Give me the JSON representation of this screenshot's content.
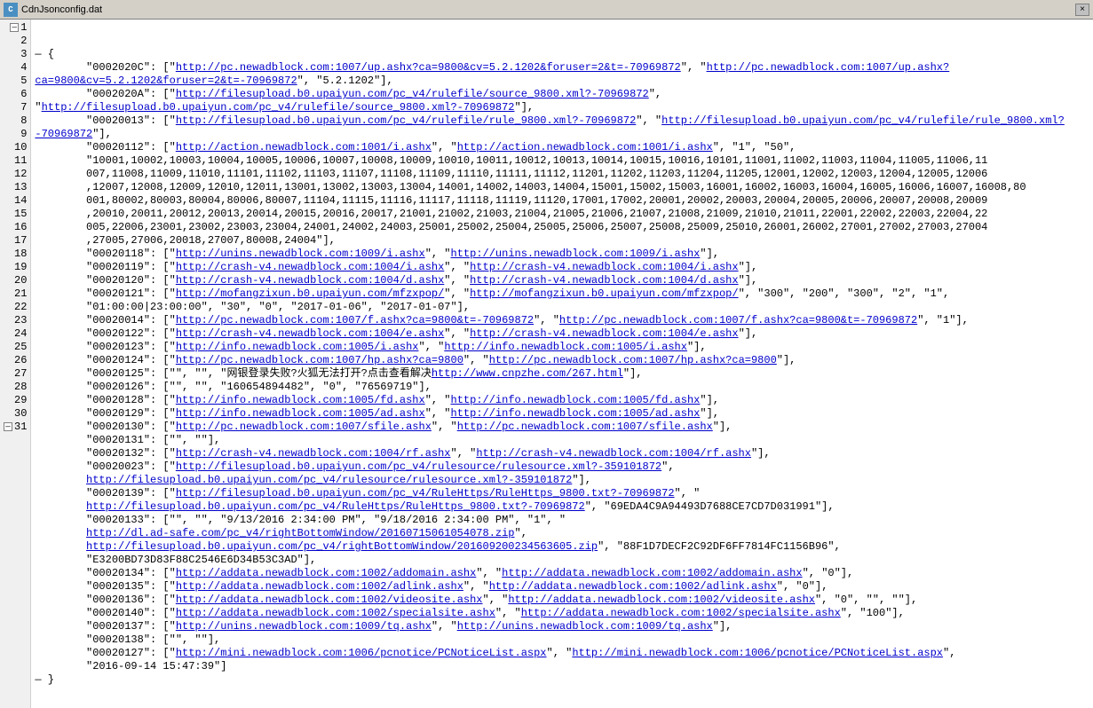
{
  "titleBar": {
    "title": "CdnJsonconfig.dat",
    "closeLabel": "×"
  },
  "lines": [
    {
      "num": 1,
      "hasCollapse": true,
      "text": "— {"
    },
    {
      "num": 2,
      "hasCollapse": false,
      "text": "        \"0002020C\": [\"<a>http://pc.newadblock.com:1007/up.ashx?ca=9800&cv=5.2.1202&foruser=2&t=-70969872</a>\", \"<a>http://pc.newadblock.com:1007/up.ashx?ca=9800&cv=5.2.1202&foruser=2&t=-70969872</a>\", \"5.2.1202\"],"
    },
    {
      "num": 3,
      "hasCollapse": false,
      "text": "        \"0002020A\": [\"<a>http://filesupload.b0.upaiyun.com/pc_v4/rulefile/source_9800.xml?-70969872</a>\", \"<a>http://filesupload.b0.upaiyun.com/pc_v4/rulefile/source_9800.xml?-70969872</a>\"],"
    },
    {
      "num": 4,
      "hasCollapse": false,
      "text": "        \"00020013\": [\"<a>http://filesupload.b0.upaiyun.com/pc_v4/rulefile/rule_9800.xml?-70969872</a>\", \"<a>http://filesupload.b0.upaiyun.com/pc_v4/rulefile/rule_9800.xml?-70969872</a>\"],"
    },
    {
      "num": 5,
      "hasCollapse": false,
      "text": "        \"00020112\": [\"<a>http://action.newadblock.com:1001/i.ashx</a>\", \"<a>http://action.newadblock.com:1001/i.ashx</a>\", \"1\", \"50\",\n        \"10001,10002,10003,10004,10005,10006,10007,10008,10009,10010,10011,10012,10013,10014,10015,10016,10101,11001,11002,11003,11004,11005,11006,11\n        007,11008,11009,11010,11101,11102,11103,11107,11108,11109,11110,11111,11112,11201,11202,11203,11204,11205,12001,12002,12003,12004,12005,12006\n        ,12007,12008,12009,12010,12011,13001,13002,13003,13004,14001,14002,14003,14004,15001,15002,15003,16001,16002,16003,16004,16005,16006,16007,16008,80\n        001,80002,80003,80004,80006,80007,11104,11115,11116,11117,11118,11119,11120,17001,17002,20001,20002,20003,20004,20005,20006,20007,20008,20009\n        ,20010,20011,20012,20013,20014,20015,20016,20017,21001,21002,21003,21004,21005,21006,21007,21008,21009,21010,21011,22001,22002,22003,22004,22\n        005,22006,23001,23002,23003,23004,24001,24002,24003,25001,25002,25004,25005,25006,25007,25008,25009,25010,26001,26002,27001,27002,27003,27004\n        ,27005,27006,20018,27007,80008,24004\"],"
    },
    {
      "num": 6,
      "hasCollapse": false,
      "text": "        \"00020118\": [\"<a>http://unins.newadblock.com:1009/i.ashx</a>\", \"<a>http://unins.newadblock.com:1009/i.ashx</a>\"],"
    },
    {
      "num": 7,
      "hasCollapse": false,
      "text": "        \"00020119\": [\"<a>http://crash-v4.newadblock.com:1004/i.ashx</a>\", \"<a>http://crash-v4.newadblock.com:1004/i.ashx</a>\"],"
    },
    {
      "num": 8,
      "hasCollapse": false,
      "text": "        \"00020120\": [\"<a>http://crash-v4.newadblock.com:1004/d.ashx</a>\", \"<a>http://crash-v4.newadblock.com:1004/d.ashx</a>\"],"
    },
    {
      "num": 9,
      "hasCollapse": false,
      "text": "        \"00020121\": [\"<a>http://mofangzixun.b0.upaiyun.com/mfzxpop/</a>\", \"<a>http://mofangzixun.b0.upaiyun.com/mfzxpop/</a>\", \"300\", \"200\", \"300\", \"2\", \"1\",\n        \"01:00:00|23:00:00\", \"30\", \"0\", \"2017-01-06\", \"2017-01-07\"],"
    },
    {
      "num": 10,
      "hasCollapse": false,
      "text": "        \"00020014\": [\"<a>http://pc.newadblock.com:1007/f.ashx?ca=9800&t=-70969872</a>\", \"<a>http://pc.newadblock.com:1007/f.ashx?ca=9800&t=-70969872</a>\", \"1\"],"
    },
    {
      "num": 11,
      "hasCollapse": false,
      "text": "        \"00020122\": [\"<a>http://crash-v4.newadblock.com:1004/e.ashx</a>\", \"<a>http://crash-v4.newadblock.com:1004/e.ashx</a>\"],"
    },
    {
      "num": 12,
      "hasCollapse": false,
      "text": "        \"00020123\": [\"<a>http://info.newadblock.com:1005/i.ashx</a>\", \"<a>http://info.newadblock.com:1005/i.ashx</a>\"],"
    },
    {
      "num": 13,
      "hasCollapse": false,
      "text": "        \"00020124\": [\"<a>http://pc.newadblock.com:1007/hp.ashx?ca=9800</a>\", \"<a>http://pc.newadblock.com:1007/hp.ashx?ca=9800</a>\"],"
    },
    {
      "num": 14,
      "hasCollapse": false,
      "text": "        \"00020125\": [\"\", \"\", \"网银登录失败?火狐无法打开?点击查看解决<a>http://www.cnpzhe.com/267.html</a>\"],"
    },
    {
      "num": 15,
      "hasCollapse": false,
      "text": "        \"00020126\": [\"\", \"\", \"160654894482\", \"0\", \"76569719\"],"
    },
    {
      "num": 16,
      "hasCollapse": false,
      "text": "        \"00020128\": [\"<a>http://info.newadblock.com:1005/fd.ashx</a>\", \"<a>http://info.newadblock.com:1005/fd.ashx</a>\"],"
    },
    {
      "num": 17,
      "hasCollapse": false,
      "text": "        \"00020129\": [\"<a>http://info.newadblock.com:1005/ad.ashx</a>\", \"<a>http://info.newadblock.com:1005/ad.ashx</a>\"],"
    },
    {
      "num": 18,
      "hasCollapse": false,
      "text": "        \"00020130\": [\"<a>http://pc.newadblock.com:1007/sfile.ashx</a>\", \"<a>http://pc.newadblock.com:1007/sfile.ashx</a>\"],"
    },
    {
      "num": 19,
      "hasCollapse": false,
      "text": "        \"00020131\": [\"\", \"\"],"
    },
    {
      "num": 20,
      "hasCollapse": false,
      "text": "        \"00020132\": [\"<a>http://crash-v4.newadblock.com:1004/rf.ashx</a>\", \"<a>http://crash-v4.newadblock.com:1004/rf.ashx</a>\"],"
    },
    {
      "num": 21,
      "hasCollapse": false,
      "text": "        \"00020023\": [\"<a>http://filesupload.b0.upaiyun.com/pc_v4/rulesource/rulesource.xml?-359101872</a>\",\n        <a>http://filesupload.b0.upaiyun.com/pc_v4/rulesource/rulesource.xml?-359101872</a>\"],"
    },
    {
      "num": 22,
      "hasCollapse": false,
      "text": "        \"00020139\": [\"<a>http://filesupload.b0.upaiyun.com/pc_v4/RuleHttps/RuleHttps_9800.txt?-70969872</a>\", \"\n        <a>http://filesupload.b0.upaiyun.com/pc_v4/RuleHttps/RuleHttps_9800.txt?-70969872</a>\", \"69EDA4C9A94493D7688CE7CD7D031991\"],"
    },
    {
      "num": 23,
      "hasCollapse": false,
      "text": "        \"00020133\": [\"\", \"\", \"9/13/2016 2:34:00 PM\", \"9/18/2016 2:34:00 PM\", \"1\", \"\n        <a>http://dl.ad-safe.com/pc_v4/rightBottomWindow/20160715061054078.zip</a>\",\n        <a>http://filesupload.b0.upaiyun.com/pc_v4/rightBottomWindow/201609200234563605.zip</a>\", \"88F1D7DECF2C92DF6FF7814FC1156B96\",\n        \"E3200BD73D83F88C2546E6D34B53C3AD\"],"
    },
    {
      "num": 24,
      "hasCollapse": false,
      "text": "        \"00020134\": [\"<a>http://addata.newadblock.com:1002/addomain.ashx</a>\", \"<a>http://addata.newadblock.com:1002/addomain.ashx</a>\", \"0\"],"
    },
    {
      "num": 25,
      "hasCollapse": false,
      "text": "        \"00020135\": [\"<a>http://addata.newadblock.com:1002/adlink.ashx</a>\", \"<a>http://addata.newadblock.com:1002/adlink.ashx</a>\", \"0\"],"
    },
    {
      "num": 26,
      "hasCollapse": false,
      "text": "        \"00020136\": [\"<a>http://addata.newadblock.com:1002/videosite.ashx</a>\", \"<a>http://addata.newadblock.com:1002/videosite.ashx</a>\", \"0\", \"\", \"\"],"
    },
    {
      "num": 27,
      "hasCollapse": false,
      "text": "        \"00020140\": [\"<a>http://addata.newadblock.com:1002/specialsite.ashx</a>\", \"<a>http://addata.newadblock.com:1002/specialsite.ashx</a>\", \"100\"],"
    },
    {
      "num": 28,
      "hasCollapse": false,
      "text": "        \"00020137\": [\"<a>http://unins.newadblock.com:1009/tq.ashx</a>\", \"<a>http://unins.newadblock.com:1009/tq.ashx</a>\"],"
    },
    {
      "num": 29,
      "hasCollapse": false,
      "text": "        \"00020138\": [\"\", \"\"],"
    },
    {
      "num": 30,
      "hasCollapse": false,
      "text": "        \"00020127\": [\"<a>http://mini.newadblock.com:1006/pcnotice/PCNoticeList.aspx</a>\", \"<a>http://mini.newadblock.com:1006/pcnotice/PCNoticeList.aspx</a>\",\n        \"2016-09-14 15:47:39\"]"
    },
    {
      "num": 31,
      "hasCollapse": true,
      "text": "— }"
    }
  ]
}
